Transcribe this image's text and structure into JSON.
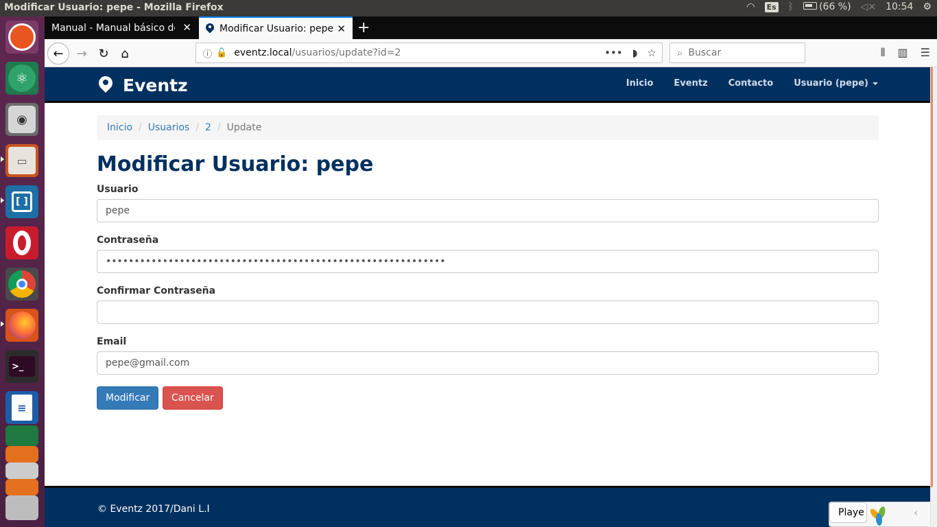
{
  "os": {
    "window_title": "Modificar Usuario: pepe - Mozilla Firefox",
    "keyboard_layout": "Es",
    "battery": "(66 %)",
    "clock": "10:54"
  },
  "browser": {
    "tabs": [
      {
        "label": "Manual - Manual básico de ("
      },
      {
        "label": "Modificar Usuario: pepe"
      }
    ],
    "url_host": "eventz.local",
    "url_path": "/usuarios/update?id=2",
    "url_actions": "•••",
    "search_placeholder": "Buscar"
  },
  "site": {
    "brand": "Eventz",
    "menu": [
      {
        "label": "Inicio"
      },
      {
        "label": "Eventz"
      },
      {
        "label": "Contacto"
      },
      {
        "label": "Usuario (pepe)"
      }
    ]
  },
  "breadcrumb": [
    {
      "label": "Inicio"
    },
    {
      "label": "Usuarios"
    },
    {
      "label": "2"
    },
    {
      "label": "Update"
    }
  ],
  "page": {
    "title": "Modificar Usuario: pepe"
  },
  "form": {
    "usuario_label": "Usuario",
    "usuario_value": "pepe",
    "password_label": "Contraseña",
    "password_value": "••••••••••••••••••••••••••••••••••••••••••••••••••••••••••••",
    "confirm_label": "Confirmar Contraseña",
    "confirm_value": "",
    "email_label": "Email",
    "email_value": "pepe@gmail.com",
    "submit_label": "Modificar",
    "cancel_label": "Cancelar"
  },
  "footer": {
    "copyright": "© Eventz 2017/Dani L.I"
  },
  "debug": {
    "label": "Playe",
    "chevron": "‹"
  },
  "colors": {
    "navbar": "#00305f",
    "primary": "#337ab7",
    "danger": "#d9534f",
    "launcher": "#5e2750"
  }
}
